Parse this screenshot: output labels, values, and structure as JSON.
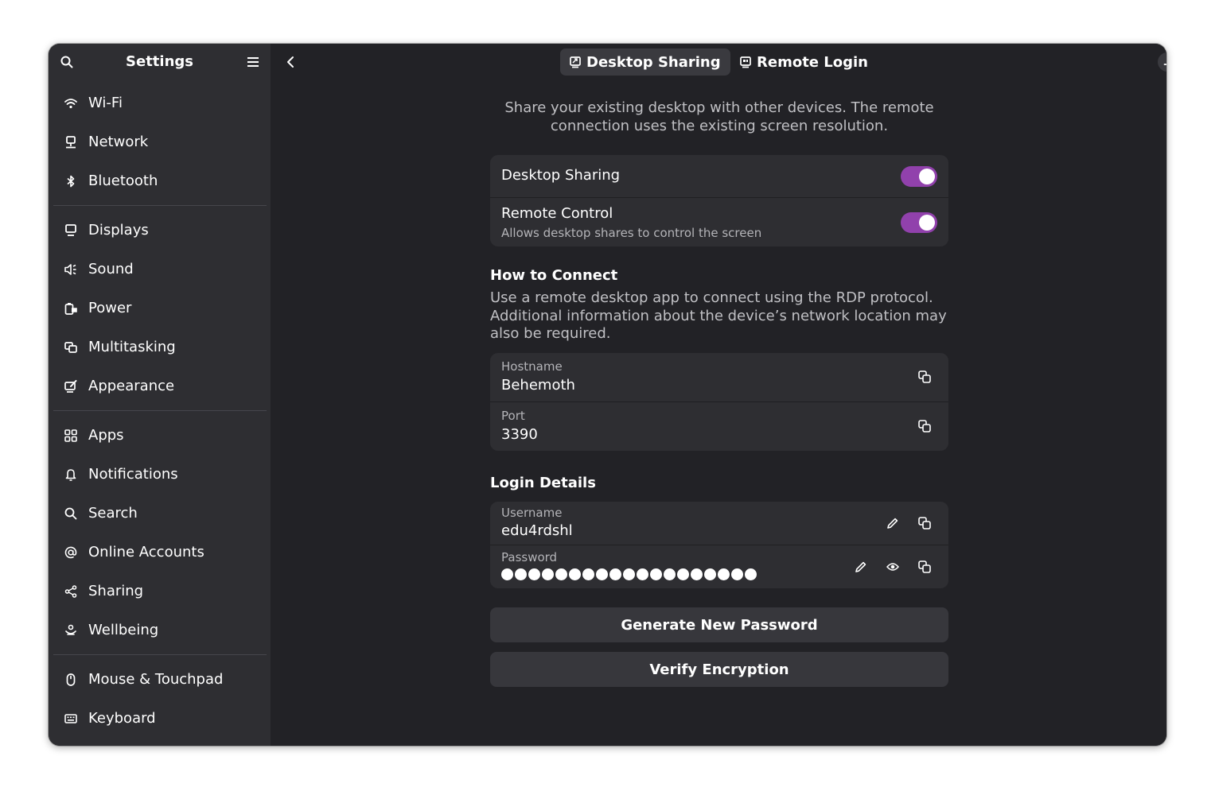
{
  "sidebar": {
    "title": "Settings",
    "search_icon": "search-icon",
    "menu_icon": "menu-icon",
    "groups": [
      [
        {
          "label": "Wi-Fi",
          "icon": "wifi-icon"
        },
        {
          "label": "Network",
          "icon": "network-icon"
        },
        {
          "label": "Bluetooth",
          "icon": "bluetooth-icon"
        }
      ],
      [
        {
          "label": "Displays",
          "icon": "display-icon"
        },
        {
          "label": "Sound",
          "icon": "sound-icon"
        },
        {
          "label": "Power",
          "icon": "power-icon"
        },
        {
          "label": "Multitasking",
          "icon": "multitasking-icon"
        },
        {
          "label": "Appearance",
          "icon": "appearance-icon"
        }
      ],
      [
        {
          "label": "Apps",
          "icon": "apps-icon"
        },
        {
          "label": "Notifications",
          "icon": "bell-icon"
        },
        {
          "label": "Search",
          "icon": "search-icon"
        },
        {
          "label": "Online Accounts",
          "icon": "at-icon"
        },
        {
          "label": "Sharing",
          "icon": "share-icon"
        },
        {
          "label": "Wellbeing",
          "icon": "wellbeing-icon"
        }
      ],
      [
        {
          "label": "Mouse & Touchpad",
          "icon": "mouse-icon"
        },
        {
          "label": "Keyboard",
          "icon": "keyboard-icon"
        }
      ]
    ]
  },
  "header": {
    "tabs": [
      {
        "label": "Desktop Sharing",
        "icon": "desktop-sharing-icon",
        "active": true
      },
      {
        "label": "Remote Login",
        "icon": "remote-login-icon",
        "active": false
      }
    ]
  },
  "main": {
    "description": "Share your existing desktop with other devices. The remote connection uses the existing screen resolution.",
    "toggles": [
      {
        "title": "Desktop Sharing",
        "subtitle": "",
        "on": true
      },
      {
        "title": "Remote Control",
        "subtitle": "Allows desktop shares to control the screen",
        "on": true
      }
    ],
    "how_to_connect": {
      "title": "How to Connect",
      "description": "Use a remote desktop app to connect using the RDP protocol. Additional information about the device’s network location may also be required.",
      "hostname_label": "Hostname",
      "hostname_value": "Behemoth",
      "port_label": "Port",
      "port_value": "3390"
    },
    "login_details": {
      "title": "Login Details",
      "username_label": "Username",
      "username_value": "edu4rdshl",
      "password_label": "Password",
      "password_value": "●●●●●●●●●●●●●●●●●●●"
    },
    "buttons": {
      "generate": "Generate New Password",
      "verify": "Verify Encryption"
    }
  },
  "colors": {
    "accent": "#9141ac",
    "window_bg": "#222226",
    "sidebar_bg": "#2e2e32",
    "card_bg": "#2e2e32"
  }
}
